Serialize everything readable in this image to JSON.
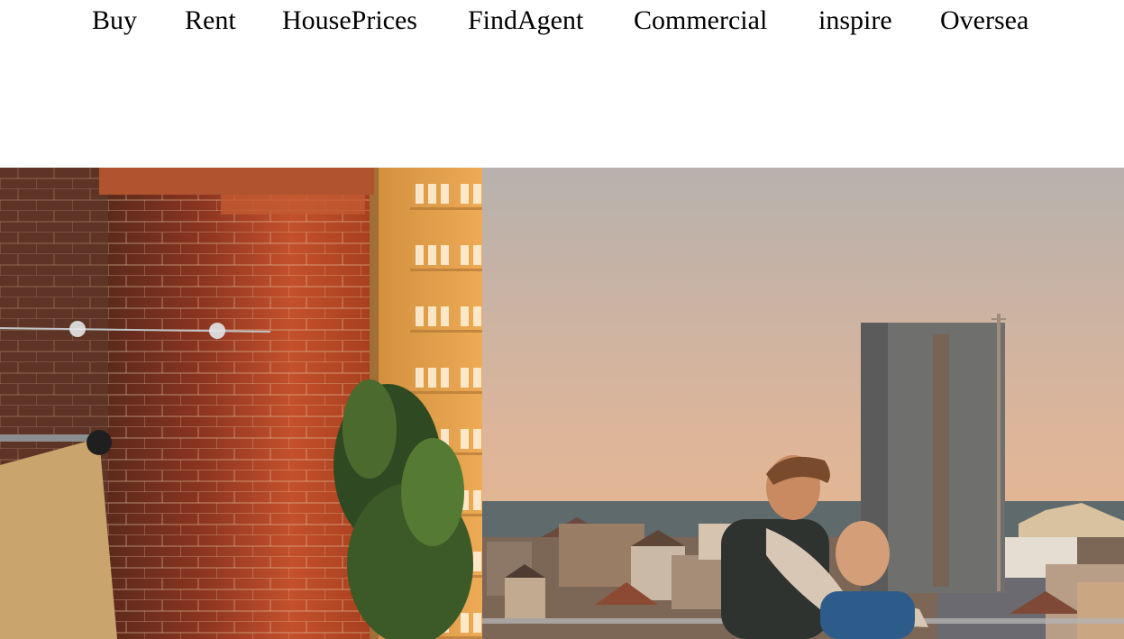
{
  "nav": {
    "items": [
      {
        "label": "Buy"
      },
      {
        "label": "Rent"
      },
      {
        "label": "HousePrices"
      },
      {
        "label": "FindAgent"
      },
      {
        "label": "Commercial"
      },
      {
        "label": "inspire"
      },
      {
        "label": "Oversea"
      }
    ]
  },
  "hero": {
    "image": "hero-photo-rooftop-sunset-sea-view",
    "colors": {
      "sky_top": "#b7b1ad",
      "sky_bottom": "#ecb88a",
      "sea": "#5f6a6c",
      "brick": "#b8452a",
      "facade": "#e6a24f"
    }
  }
}
